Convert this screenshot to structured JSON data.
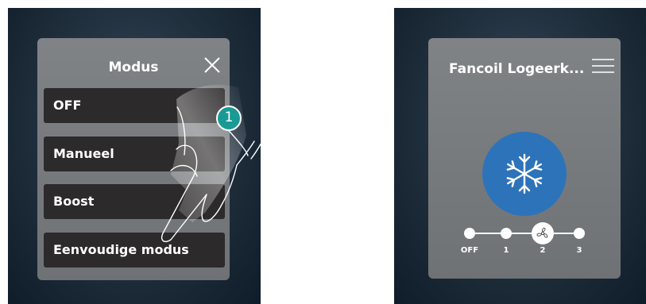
{
  "mode_menu": {
    "title": "Modus",
    "items": [
      "OFF",
      "Manueel",
      "Boost",
      "Eenvoudige modus"
    ]
  },
  "step_badge": "1",
  "fancoil": {
    "title": "Fancoil Logeerk...",
    "mode_icon": "snowflake-icon",
    "speed": {
      "labels": [
        "OFF",
        "1",
        "2",
        "3"
      ],
      "selected": "2"
    }
  },
  "colors": {
    "panel": "#77797c",
    "menu_item": "#2c2a2a",
    "mode_circle": "#2d73ba",
    "step_badge": "#1a9a95"
  }
}
